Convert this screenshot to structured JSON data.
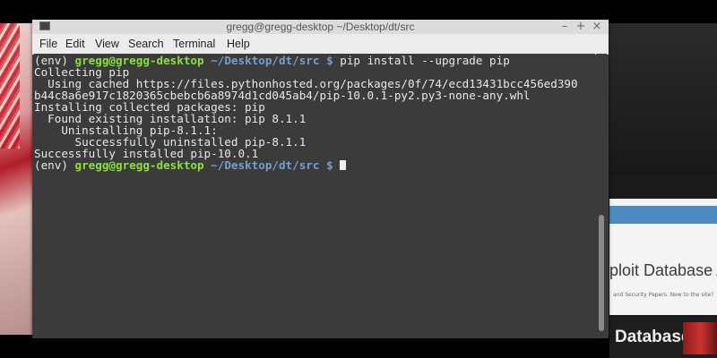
{
  "window": {
    "title": "gregg@gregg-desktop ~/Desktop/dt/src",
    "controls": {
      "minimize": "–",
      "maximize": "+",
      "close": "×"
    }
  },
  "menu": [
    "File",
    "Edit",
    "View",
    "Search",
    "Terminal",
    "Help"
  ],
  "prompt": {
    "env": "(env) ",
    "user_host": "gregg@gregg-desktop",
    "path": "~/Desktop/dt/src",
    "symbol": " $ "
  },
  "terminal": {
    "command": "pip install --upgrade pip",
    "output": [
      "Collecting pip",
      "  Using cached https://files.pythonhosted.org/packages/0f/74/ecd13431bcc456ed390",
      "b44c8a6e917c1820365cbebcb6a8974d1cd045ab4/pip-10.0.1-py2.py3-none-any.whl",
      "Installing collected packages: pip",
      "  Found existing installation: pip 8.1.1",
      "    Uninstalling pip-8.1.1:",
      "      Successfully uninstalled pip-8.1.1",
      "Successfully installed pip-10.0.1"
    ]
  },
  "background": {
    "site_title": "ploit Database Ar",
    "site_small": "and Security Papers. New to the site?",
    "database_label": "Database"
  }
}
